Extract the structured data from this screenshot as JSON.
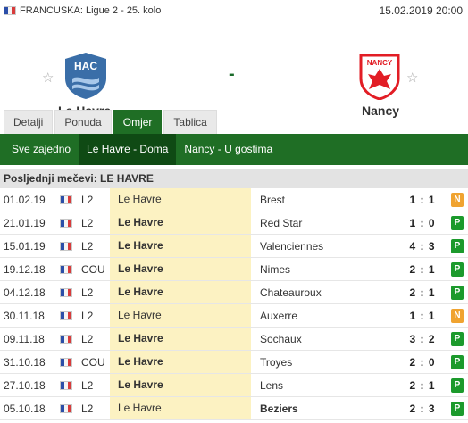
{
  "header": {
    "league": "FRANCUSKA: Ligue 2 - 25. kolo",
    "date": "15.02.2019 20:00"
  },
  "match": {
    "home": {
      "name": "Le Havre",
      "logo_text": "HAC"
    },
    "separator": "-",
    "away": {
      "name": "Nancy",
      "logo_text": "NANCY"
    }
  },
  "tabs": [
    "Detalji",
    "Ponuda",
    "Omjer",
    "Tablica"
  ],
  "active_tab": "Omjer",
  "subtabs": [
    "Sve zajedno",
    "Le Havre - Doma",
    "Nancy - U gostima"
  ],
  "active_subtab": "Le Havre - Doma",
  "section_title": "Posljednji mečevi: LE HAVRE",
  "matches": [
    {
      "date": "01.02.19",
      "comp": "L2",
      "home": "Le Havre",
      "away": "Brest",
      "score": "1 : 1",
      "result": "N"
    },
    {
      "date": "21.01.19",
      "comp": "L2",
      "home": "Le Havre",
      "away": "Red Star",
      "score": "1 : 0",
      "result": "P"
    },
    {
      "date": "15.01.19",
      "comp": "L2",
      "home": "Le Havre",
      "away": "Valenciennes",
      "score": "4 : 3",
      "result": "P"
    },
    {
      "date": "19.12.18",
      "comp": "COU",
      "home": "Le Havre",
      "away": "Nimes",
      "score": "2 : 1",
      "result": "P"
    },
    {
      "date": "04.12.18",
      "comp": "L2",
      "home": "Le Havre",
      "away": "Chateauroux",
      "score": "2 : 1",
      "result": "P"
    },
    {
      "date": "30.11.18",
      "comp": "L2",
      "home": "Le Havre",
      "away": "Auxerre",
      "score": "1 : 1",
      "result": "N"
    },
    {
      "date": "09.11.18",
      "comp": "L2",
      "home": "Le Havre",
      "away": "Sochaux",
      "score": "3 : 2",
      "result": "P"
    },
    {
      "date": "31.10.18",
      "comp": "COU",
      "home": "Le Havre",
      "away": "Troyes",
      "score": "2 : 0",
      "result": "P"
    },
    {
      "date": "27.10.18",
      "comp": "L2",
      "home": "Le Havre",
      "away": "Lens",
      "score": "2 : 1",
      "result": "P"
    },
    {
      "date": "05.10.18",
      "comp": "L2",
      "home": "Le Havre",
      "away": "Beziers",
      "score": "2 : 3",
      "result": "P"
    }
  ],
  "colors": {
    "green": "#1f6e25",
    "win": "#1c9a2c",
    "draw": "#f0a330",
    "highlight": "#fcf2c2"
  }
}
